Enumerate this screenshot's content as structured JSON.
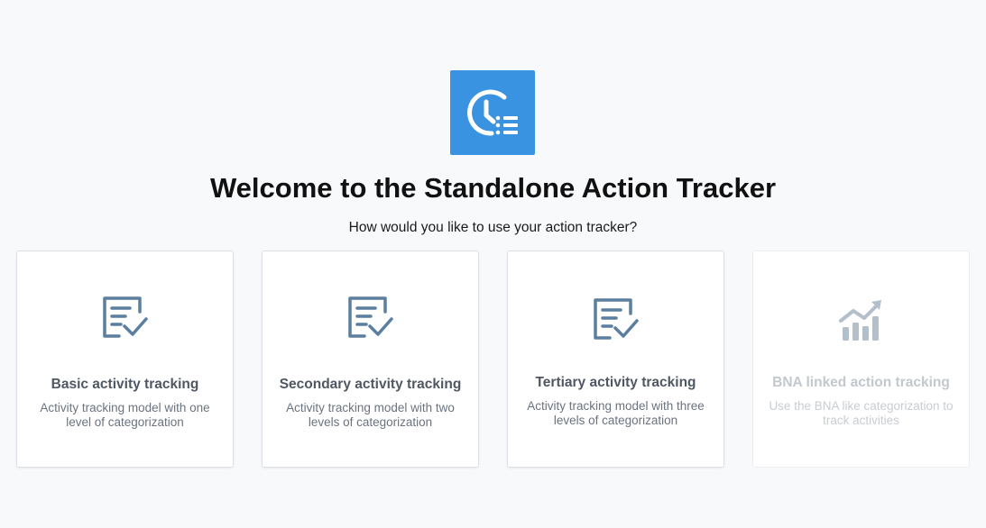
{
  "app": {
    "logo_icon": "clock-list-icon",
    "accent_color": "#3a93e0"
  },
  "header": {
    "title": "Welcome to the Standalone Action Tracker",
    "subtitle": "How would you like to use your action tracker?"
  },
  "options": [
    {
      "title": "Basic activity tracking",
      "description": "Activity tracking model with one level of categorization",
      "icon": "checklist-icon",
      "enabled": true
    },
    {
      "title": "Secondary activity tracking",
      "description": "Activity tracking model with two levels of categorization",
      "icon": "checklist-icon",
      "enabled": true
    },
    {
      "title": "Tertiary activity tracking",
      "description": "Activity tracking model with three levels of categorization",
      "icon": "checklist-icon",
      "enabled": true
    },
    {
      "title": "BNA linked action tracking",
      "description": "Use the BNA like categorization to track activities",
      "icon": "trend-chart-icon",
      "enabled": false
    }
  ]
}
